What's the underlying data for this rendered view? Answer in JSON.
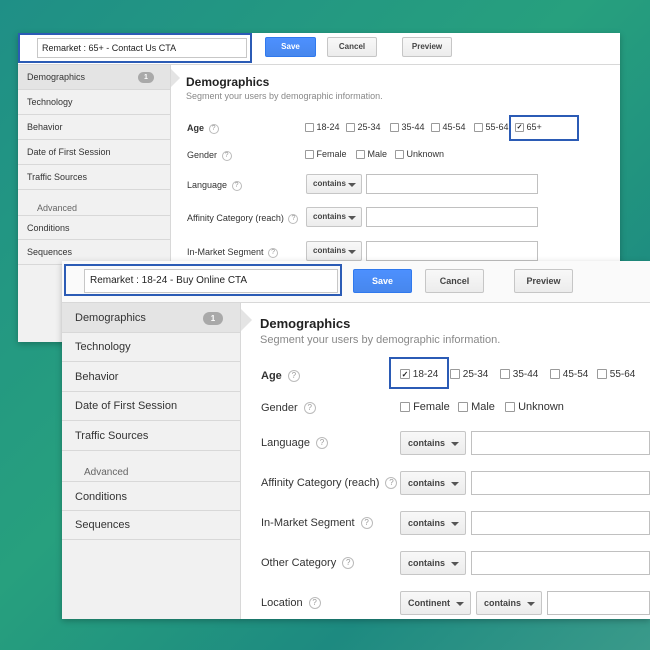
{
  "back": {
    "segment_name": "Remarket :  65+  - Contact Us CTA",
    "buttons": {
      "save": "Save",
      "cancel": "Cancel",
      "preview": "Preview"
    },
    "sidebar": {
      "items": [
        "Demographics",
        "Technology",
        "Behavior",
        "Date of First Session",
        "Traffic Sources"
      ],
      "badge": "1",
      "advanced_header": "Advanced",
      "advanced_items": [
        "Conditions",
        "Sequences"
      ]
    },
    "main": {
      "title": "Demographics",
      "subtitle": "Segment your users by demographic information.",
      "age_label": "Age",
      "age_options": [
        "18-24",
        "25-34",
        "35-44",
        "45-54",
        "55-64",
        "65+"
      ],
      "gender_label": "Gender",
      "gender_options": [
        "Female",
        "Male",
        "Unknown"
      ],
      "language_label": "Language",
      "affinity_label": "Affinity Category (reach)",
      "inmarket_label": "In-Market Segment",
      "contains": "contains"
    }
  },
  "front": {
    "segment_name": "Remarket :  18-24  - Buy Online CTA",
    "buttons": {
      "save": "Save",
      "cancel": "Cancel",
      "preview": "Preview"
    },
    "sidebar": {
      "items": [
        "Demographics",
        "Technology",
        "Behavior",
        "Date of First Session",
        "Traffic Sources"
      ],
      "badge": "1",
      "advanced_header": "Advanced",
      "advanced_items": [
        "Conditions",
        "Sequences"
      ]
    },
    "main": {
      "title": "Demographics",
      "subtitle": "Segment your users by demographic information.",
      "age_label": "Age",
      "age_options": [
        "18-24",
        "25-34",
        "35-44",
        "45-54",
        "55-64"
      ],
      "gender_label": "Gender",
      "gender_options": [
        "Female",
        "Male",
        "Unknown"
      ],
      "language_label": "Language",
      "affinity_label": "Affinity Category (reach)",
      "inmarket_label": "In-Market Segment",
      "other_label": "Other Category",
      "location_label": "Location",
      "contains": "contains",
      "continent": "Continent"
    }
  },
  "help_glyph": "?",
  "colors": {
    "highlight": "#2b5bb5",
    "save": "#4d90fe"
  }
}
